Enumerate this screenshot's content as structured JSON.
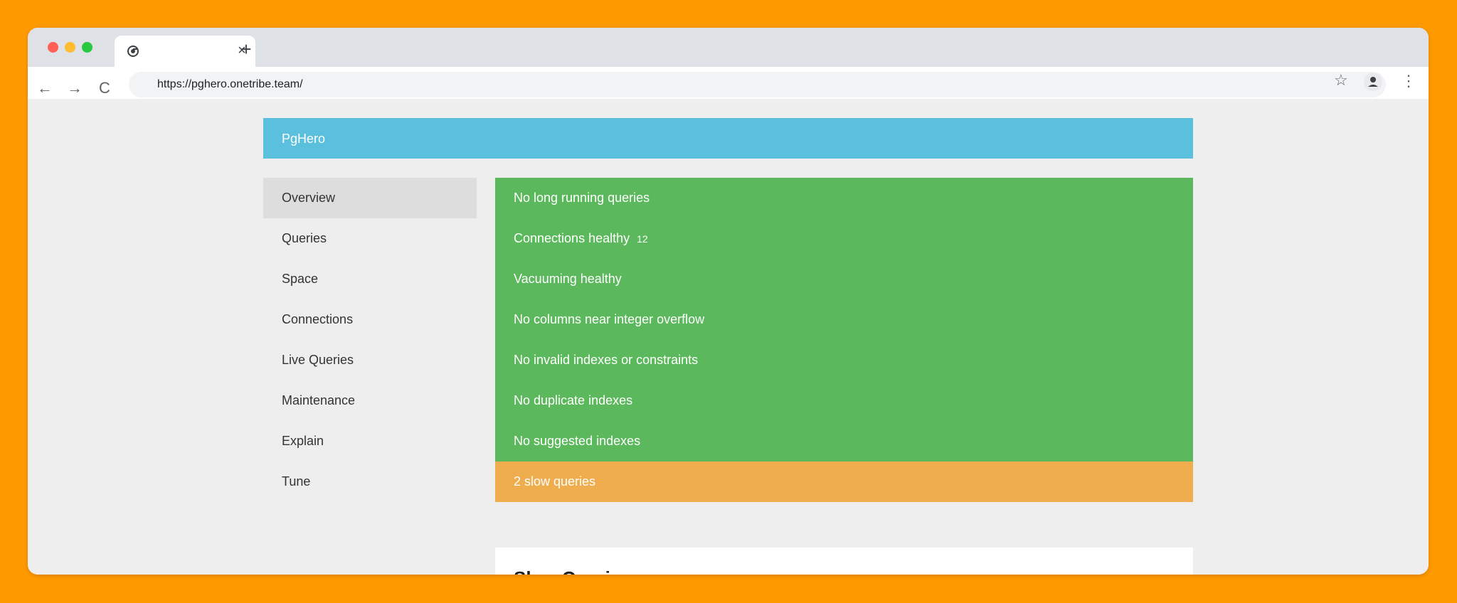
{
  "browser": {
    "tab_close": "×",
    "new_tab": "+",
    "back": "←",
    "forward": "→",
    "reload": "C",
    "url": "https://pghero.onetribe.team/",
    "bookmark": "☆",
    "menu": "⋮"
  },
  "app": {
    "brand": "PgHero"
  },
  "sidebar": {
    "items": [
      {
        "label": "Overview",
        "active": true
      },
      {
        "label": "Queries"
      },
      {
        "label": "Space"
      },
      {
        "label": "Connections"
      },
      {
        "label": "Live Queries"
      },
      {
        "label": "Maintenance"
      },
      {
        "label": "Explain"
      },
      {
        "label": "Tune"
      }
    ]
  },
  "alerts": {
    "items": [
      {
        "text": "No long running queries",
        "status": "ok"
      },
      {
        "text": "Connections healthy",
        "badge": "12",
        "status": "ok"
      },
      {
        "text": "Vacuuming healthy",
        "status": "ok"
      },
      {
        "text": "No columns near integer overflow",
        "status": "ok"
      },
      {
        "text": "No invalid indexes or constraints",
        "status": "ok"
      },
      {
        "text": "No duplicate indexes",
        "status": "ok"
      },
      {
        "text": "No suggested indexes",
        "status": "ok"
      },
      {
        "text": "2 slow queries",
        "status": "warn"
      }
    ]
  },
  "main": {
    "panel_title": "Slow Queries"
  },
  "colors": {
    "background": "#ff9900",
    "navbar": "#5bc0de",
    "success": "#5cb85c",
    "warning": "#f0ad4e"
  },
  "icons": [
    "chrome-icon",
    "close-icon",
    "plus-icon",
    "back-arrow-icon",
    "forward-arrow-icon",
    "reload-icon",
    "star-icon",
    "profile-icon",
    "more-icon"
  ]
}
